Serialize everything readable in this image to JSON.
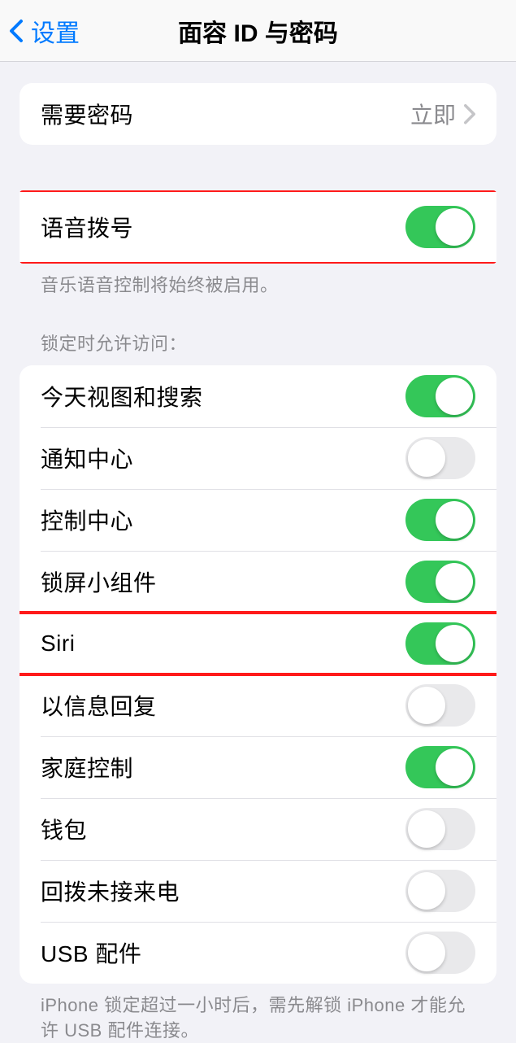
{
  "nav": {
    "back_label": "设置",
    "title": "面容 ID 与密码"
  },
  "require_passcode": {
    "label": "需要密码",
    "value": "立即"
  },
  "voice_dial": {
    "label": "语音拨号",
    "footer": "音乐语音控制将始终被启用。"
  },
  "lock_access": {
    "header": "锁定时允许访问：",
    "items": [
      {
        "label": "今天视图和搜索",
        "on": true
      },
      {
        "label": "通知中心",
        "on": false
      },
      {
        "label": "控制中心",
        "on": true
      },
      {
        "label": "锁屏小组件",
        "on": true
      },
      {
        "label": "Siri",
        "on": true
      },
      {
        "label": "以信息回复",
        "on": false
      },
      {
        "label": "家庭控制",
        "on": true
      },
      {
        "label": "钱包",
        "on": false
      },
      {
        "label": "回拨未接来电",
        "on": false
      },
      {
        "label": "USB 配件",
        "on": false
      }
    ],
    "footer": "iPhone 锁定超过一小时后，需先解锁 iPhone 才能允许 USB 配件连接。"
  }
}
